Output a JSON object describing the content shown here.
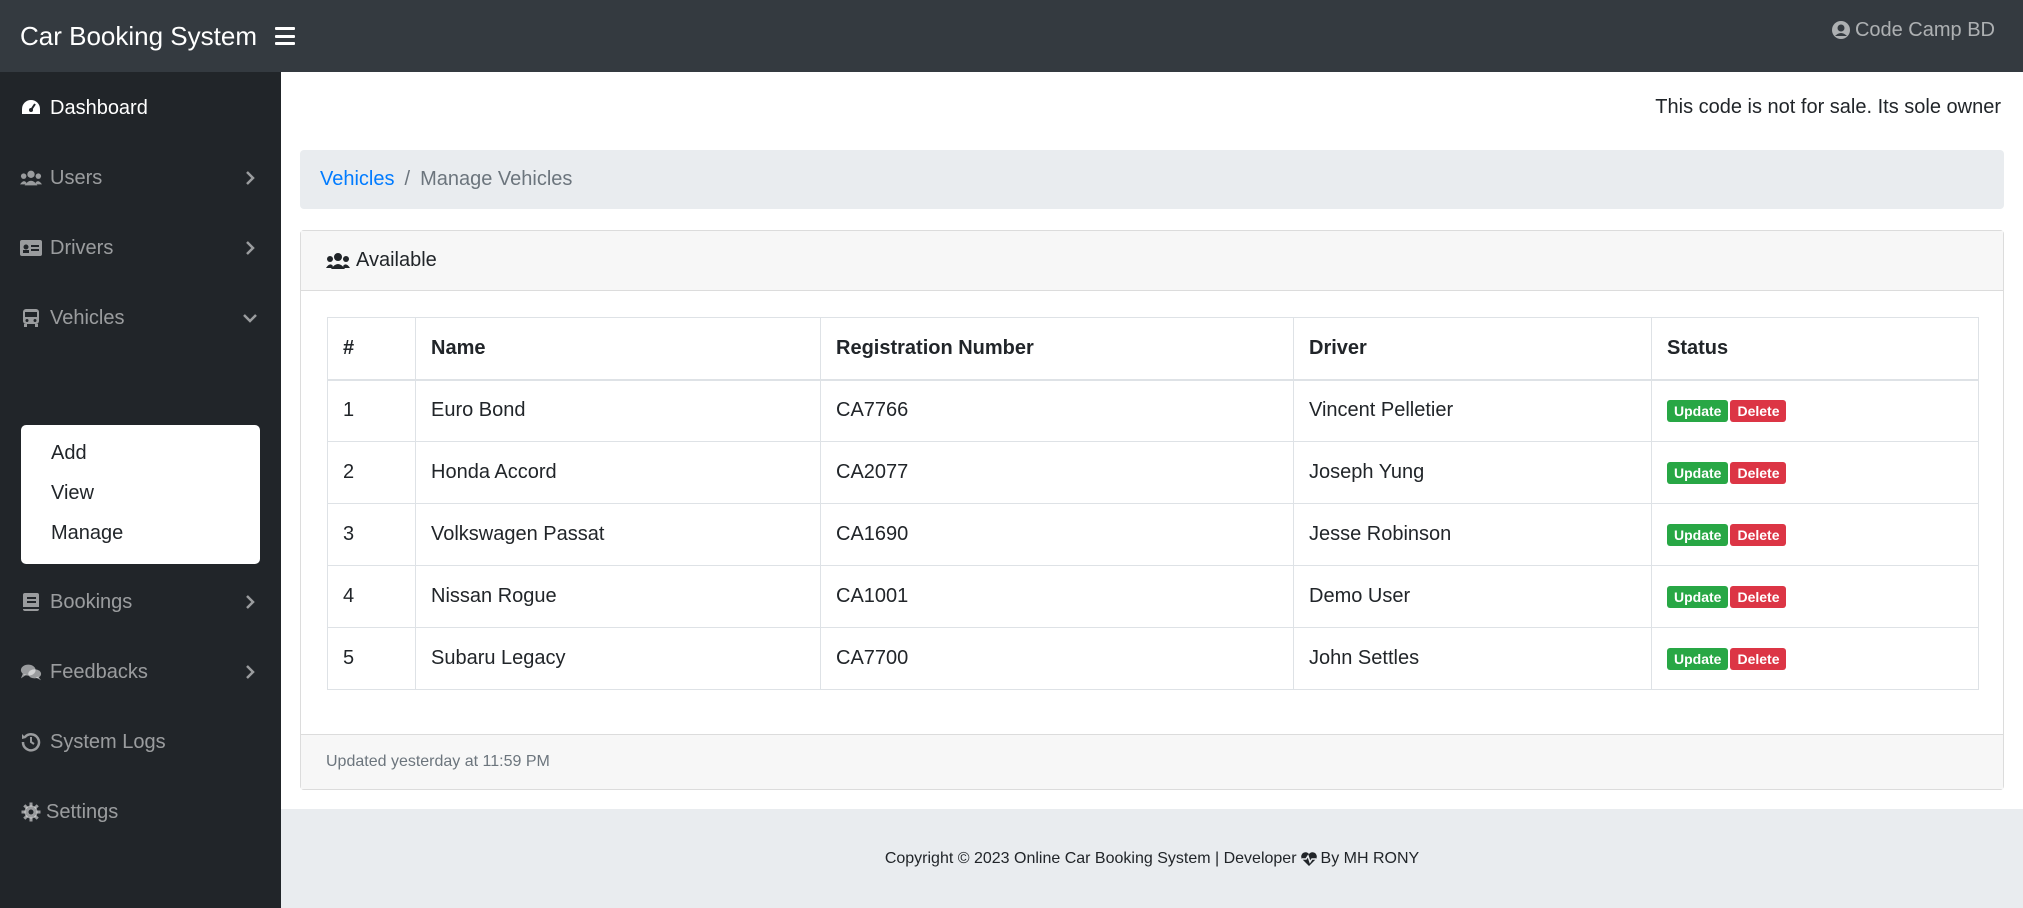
{
  "header": {
    "brand": "Car Booking System",
    "user_name": "Code Camp BD"
  },
  "sidebar": {
    "items": [
      {
        "label": "Dashboard",
        "icon": "tachometer-icon"
      },
      {
        "label": "Users",
        "icon": "users-icon"
      },
      {
        "label": "Drivers",
        "icon": "id-card-icon"
      },
      {
        "label": "Vehicles",
        "icon": "bus-icon"
      },
      {
        "label": "Bookings",
        "icon": "book-icon"
      },
      {
        "label": "Feedbacks",
        "icon": "comments-icon"
      },
      {
        "label": "System Logs",
        "icon": "history-icon"
      },
      {
        "label": "Settings",
        "icon": "gear-icon"
      }
    ],
    "vehicles_submenu": [
      "Add",
      "View",
      "Manage"
    ]
  },
  "notice": "This code is not for sale. Its sole owner",
  "breadcrumb": {
    "parent": "Vehicles",
    "current": "Manage Vehicles"
  },
  "card": {
    "title": "Available",
    "footer": "Updated yesterday at 11:59 PM"
  },
  "table": {
    "headers": [
      "#",
      "Name",
      "Registration Number",
      "Driver",
      "Status"
    ],
    "rows": [
      {
        "num": "1",
        "name": "Euro Bond",
        "reg": "CA7766",
        "driver": "Vincent Pelletier"
      },
      {
        "num": "2",
        "name": "Honda Accord",
        "reg": "CA2077",
        "driver": "Joseph Yung"
      },
      {
        "num": "3",
        "name": "Volkswagen Passat",
        "reg": "CA1690",
        "driver": "Jesse Robinson"
      },
      {
        "num": "4",
        "name": "Nissan Rogue",
        "reg": "CA1001",
        "driver": "Demo User"
      },
      {
        "num": "5",
        "name": "Subaru Legacy",
        "reg": "CA7700",
        "driver": "John Settles"
      }
    ],
    "update_label": "Update",
    "delete_label": "Delete"
  },
  "footer": {
    "copyright": "Copyright © 2023 Online Car Booking System | Developer",
    "author": "By MH RONY"
  },
  "colors": {
    "navbar": "#343a40",
    "sidebar": "#212529",
    "link": "#007bff",
    "update": "#28a745",
    "delete": "#dc3545"
  }
}
